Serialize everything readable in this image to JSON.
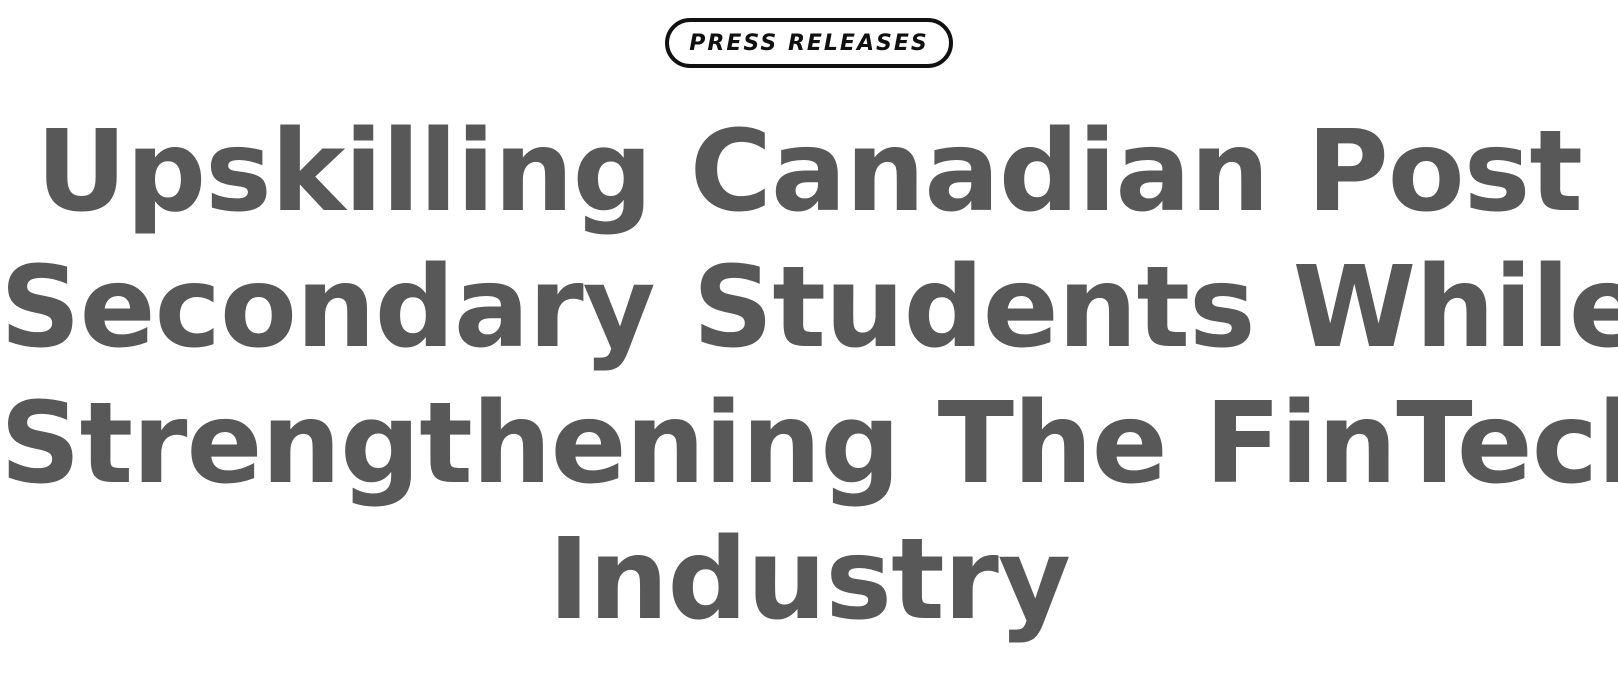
{
  "category": {
    "label": "PRESS RELEASES"
  },
  "article": {
    "title_lines": [
      "Upskilling Canadian Post",
      "Secondary Students While",
      "Strengthening The FinTech",
      "Industry"
    ]
  },
  "colors": {
    "headline": "#585858",
    "pill_border": "#111111",
    "background": "#ffffff"
  }
}
